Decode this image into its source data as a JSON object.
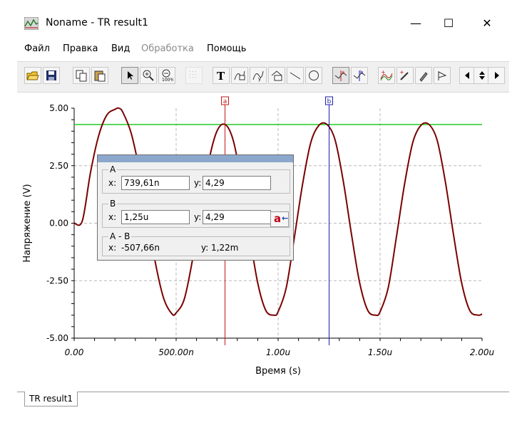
{
  "window": {
    "title": "Noname - TR result1",
    "minimize": "—",
    "maximize": "☐",
    "close": "✕"
  },
  "menu": [
    "Файл",
    "Правка",
    "Вид",
    "Обработка",
    "Помощь"
  ],
  "menu_disabled": [
    false,
    false,
    false,
    true,
    false
  ],
  "toolbar": {
    "icons": [
      "open-folder-icon",
      "save-icon",
      "copy-icon",
      "paste-icon",
      "pointer-icon",
      "zoom-in-icon",
      "zoom-100-icon",
      "grid-icon",
      "text-icon",
      "curve-label-icon",
      "curve-label-2-icon",
      "label-box-icon",
      "line-icon",
      "circle-icon",
      "cursor-a-icon",
      "cursor-b-icon",
      "add-cursor-icon",
      "add-curve-icon",
      "color-pick-icon",
      "flag-icon",
      "arrow-left-icon",
      "arrow-updown-icon",
      "arrow-right-icon"
    ]
  },
  "chart_data": {
    "type": "line",
    "xlabel": "Время (s)",
    "ylabel": "Напряжение (V)",
    "xlim": [
      0,
      2.0
    ],
    "ylim": [
      -5.0,
      5.0
    ],
    "x_unit": "µs",
    "xticks": [
      0,
      0.5,
      1.0,
      1.5,
      2.0
    ],
    "xticklabels": [
      "0.00",
      "500.00n",
      "1.00u",
      "1.50u",
      "2.00u"
    ],
    "yticks": [
      5.0,
      2.5,
      0.0,
      -2.5,
      -5.0
    ],
    "yticklabels": [
      "5.00",
      "2.50",
      "0.00",
      "-2.50",
      "-5.00"
    ],
    "grid": true,
    "series": [
      {
        "color": "#7a0000",
        "x": [
          0,
          0.04,
          0.08,
          0.12,
          0.16,
          0.2,
          0.22,
          0.24,
          0.28,
          0.32,
          0.36,
          0.4,
          0.44,
          0.48,
          0.5,
          0.54,
          0.58,
          0.62,
          0.66,
          0.7,
          0.74,
          0.78,
          0.82,
          0.86,
          0.9,
          0.94,
          0.98,
          1.0,
          1.04,
          1.08,
          1.12,
          1.16,
          1.2,
          1.24,
          1.28,
          1.32,
          1.36,
          1.4,
          1.44,
          1.48,
          1.5,
          1.54,
          1.58,
          1.62,
          1.66,
          1.7,
          1.74,
          1.78,
          1.82,
          1.86,
          1.9,
          1.94,
          1.98,
          2.0
        ],
        "y": [
          0,
          0.1,
          2.2,
          3.8,
          4.7,
          4.95,
          5.0,
          4.8,
          3.9,
          2.3,
          0.3,
          -1.8,
          -3.3,
          -3.95,
          -3.9,
          -3.3,
          -1.6,
          0.6,
          2.7,
          4.0,
          4.29,
          3.6,
          1.8,
          -0.5,
          -2.6,
          -3.8,
          -4.0,
          -3.85,
          -2.8,
          -0.6,
          1.7,
          3.5,
          4.25,
          4.29,
          3.6,
          1.8,
          -0.5,
          -2.6,
          -3.8,
          -4.0,
          -3.85,
          -2.8,
          -0.6,
          1.7,
          3.5,
          4.25,
          4.29,
          3.6,
          1.8,
          -0.5,
          -2.6,
          -3.8,
          -4.0,
          -3.95
        ]
      }
    ],
    "hline": {
      "y": 4.29,
      "color": "#22cc22"
    },
    "cursors": [
      {
        "label": "a",
        "x": 0.7396,
        "color": "#c01818"
      },
      {
        "label": "b",
        "x": 1.25,
        "color": "#1c1cb0"
      }
    ]
  },
  "cursor_panel": {
    "a": {
      "title": "A",
      "x_label": "x:",
      "x": "739,61n",
      "y_label": "y:",
      "y": "4,29"
    },
    "b": {
      "title": "B",
      "x_label": "x:",
      "x": "1,25u",
      "y_label": "y:",
      "y": "4,29"
    },
    "diff": {
      "title": "A - B",
      "x_label": "x:",
      "x": "-507,66n",
      "y_label": "y:",
      "y": "1,22m"
    },
    "swap_label": "a"
  },
  "statusbar": {
    "tab": "TR result1"
  }
}
